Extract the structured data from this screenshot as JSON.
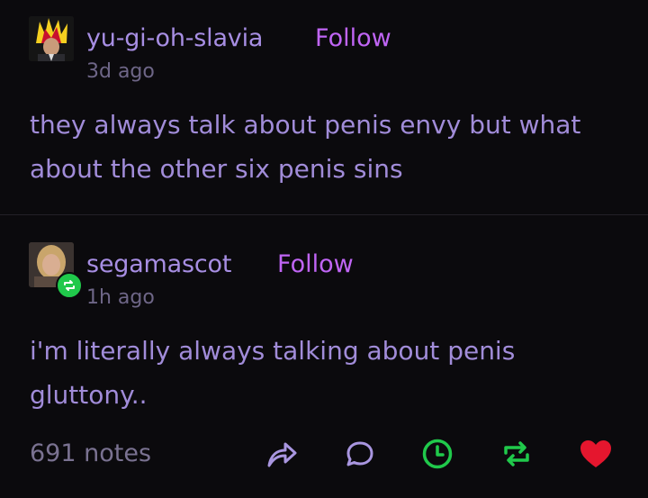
{
  "posts": [
    {
      "username": "yu-gi-oh-slavia",
      "follow_label": "Follow",
      "time": "3d ago",
      "text": "they always talk about penis envy but what about the other six penis sins"
    },
    {
      "username": "segamascot",
      "follow_label": "Follow",
      "time": "1h ago",
      "text": "i'm literally always talking about penis gluttony.."
    }
  ],
  "footer": {
    "notes": "691 notes",
    "actions": [
      "share-icon",
      "reply-icon",
      "post-later-icon",
      "reblog-icon",
      "like-icon"
    ]
  },
  "colors": {
    "background": "#0b0a0d",
    "username": "#a78ee3",
    "follow": "#c065f5",
    "text": "#a18cd9",
    "timestamp": "#6e6687",
    "green": "#20c94b",
    "like": "#e5162e"
  }
}
